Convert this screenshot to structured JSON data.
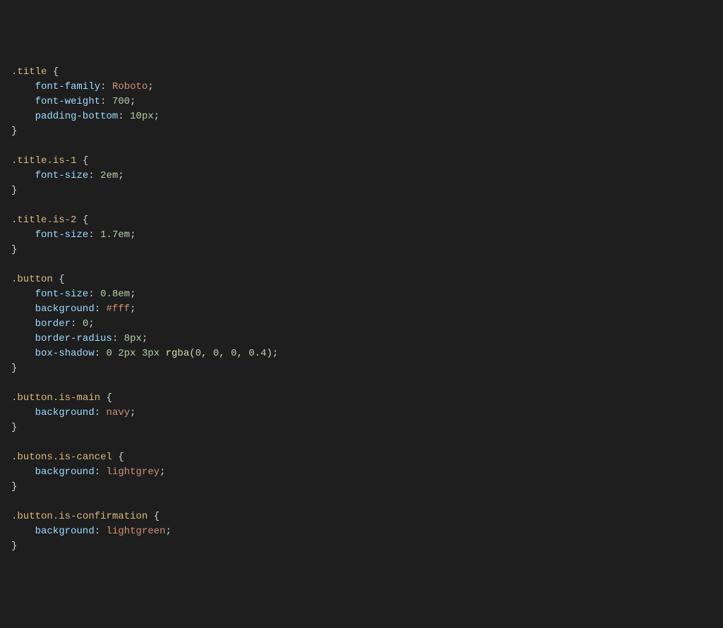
{
  "code": {
    "rules": [
      {
        "selector": ".title",
        "decls": [
          {
            "prop": "font-family",
            "val": [
              {
                "t": "ident",
                "v": "Roboto"
              }
            ]
          },
          {
            "prop": "font-weight",
            "val": [
              {
                "t": "num",
                "v": "700"
              }
            ]
          },
          {
            "prop": "padding-bottom",
            "val": [
              {
                "t": "num",
                "v": "10"
              },
              {
                "t": "unit",
                "v": "px"
              }
            ]
          }
        ]
      },
      {
        "selector": ".title.is-1",
        "decls": [
          {
            "prop": "font-size",
            "val": [
              {
                "t": "num",
                "v": "2"
              },
              {
                "t": "unit",
                "v": "em"
              }
            ]
          }
        ]
      },
      {
        "selector": ".title.is-2",
        "decls": [
          {
            "prop": "font-size",
            "val": [
              {
                "t": "num",
                "v": "1.7"
              },
              {
                "t": "unit",
                "v": "em"
              }
            ]
          }
        ]
      },
      {
        "selector": ".button",
        "decls": [
          {
            "prop": "font-size",
            "val": [
              {
                "t": "num",
                "v": "0.8"
              },
              {
                "t": "unit",
                "v": "em"
              }
            ]
          },
          {
            "prop": "background",
            "val": [
              {
                "t": "ident",
                "v": "#fff"
              }
            ]
          },
          {
            "prop": "border",
            "val": [
              {
                "t": "num",
                "v": "0"
              }
            ]
          },
          {
            "prop": "border-radius",
            "val": [
              {
                "t": "num",
                "v": "8"
              },
              {
                "t": "unit",
                "v": "px"
              }
            ]
          },
          {
            "prop": "box-shadow",
            "val": [
              {
                "t": "num",
                "v": "0"
              },
              {
                "t": "space",
                "v": " "
              },
              {
                "t": "num",
                "v": "2"
              },
              {
                "t": "unit",
                "v": "px"
              },
              {
                "t": "space",
                "v": " "
              },
              {
                "t": "num",
                "v": "3"
              },
              {
                "t": "unit",
                "v": "px"
              },
              {
                "t": "space",
                "v": " "
              },
              {
                "t": "func",
                "v": "rgba"
              },
              {
                "t": "punct",
                "v": "("
              },
              {
                "t": "num",
                "v": "0"
              },
              {
                "t": "punct",
                "v": ", "
              },
              {
                "t": "num",
                "v": "0"
              },
              {
                "t": "punct",
                "v": ", "
              },
              {
                "t": "num",
                "v": "0"
              },
              {
                "t": "punct",
                "v": ", "
              },
              {
                "t": "num",
                "v": "0.4"
              },
              {
                "t": "punct",
                "v": ")"
              }
            ]
          }
        ]
      },
      {
        "selector": ".button.is-main",
        "decls": [
          {
            "prop": "background",
            "val": [
              {
                "t": "ident",
                "v": "navy"
              }
            ]
          }
        ]
      },
      {
        "selector": ".butons.is-cancel",
        "decls": [
          {
            "prop": "background",
            "val": [
              {
                "t": "ident",
                "v": "lightgrey"
              }
            ]
          }
        ]
      },
      {
        "selector": ".button.is-confirmation",
        "decls": [
          {
            "prop": "background",
            "val": [
              {
                "t": "ident",
                "v": "lightgreen"
              }
            ]
          }
        ]
      }
    ]
  }
}
